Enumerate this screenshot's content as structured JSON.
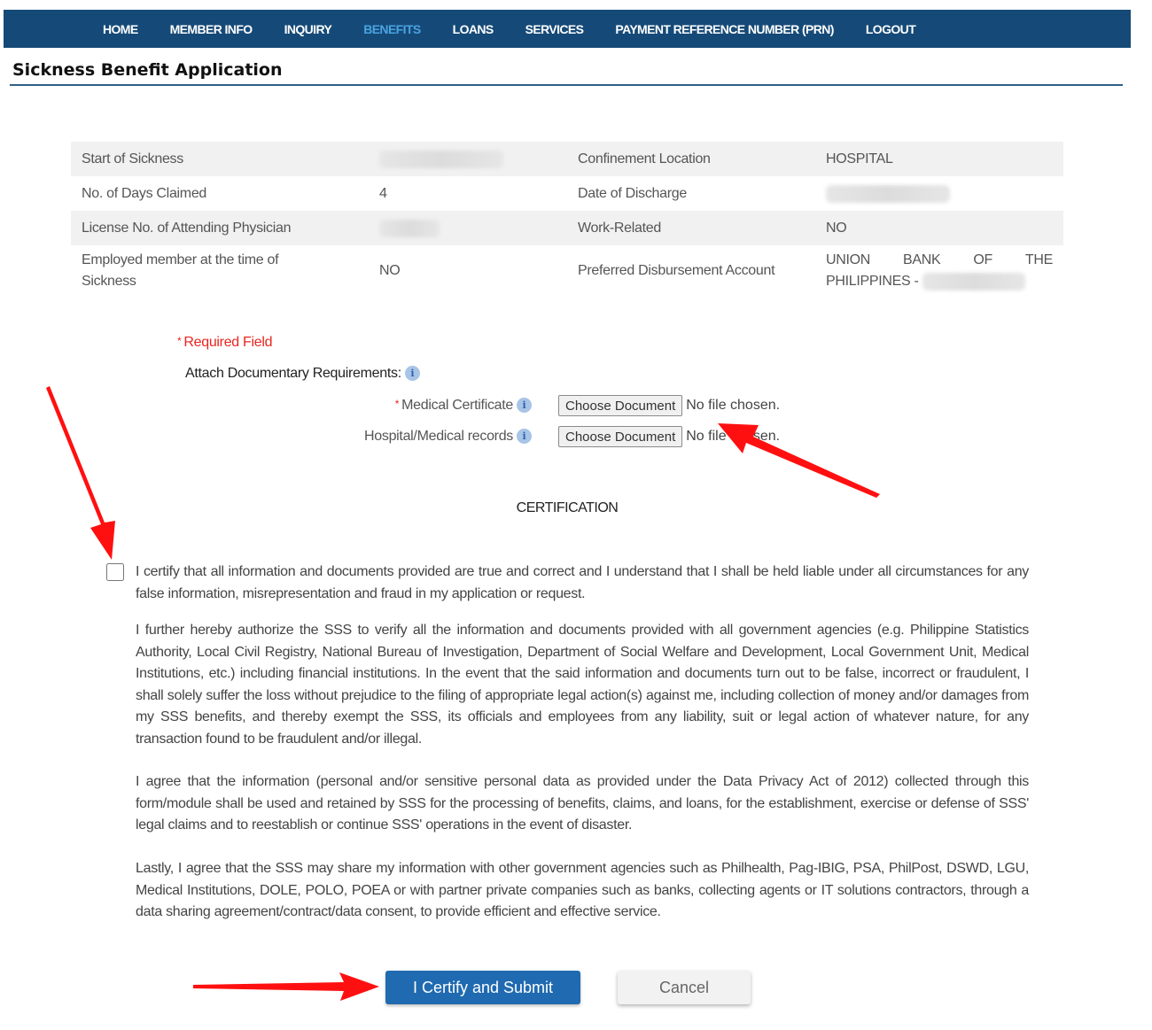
{
  "nav": {
    "items": [
      {
        "label": "HOME",
        "active": false
      },
      {
        "label": "MEMBER INFO",
        "active": false
      },
      {
        "label": "INQUIRY",
        "active": false
      },
      {
        "label": "BENEFITS",
        "active": true
      },
      {
        "label": "LOANS",
        "active": false
      },
      {
        "label": "SERVICES",
        "active": false
      },
      {
        "label": "PAYMENT REFERENCE NUMBER (PRN)",
        "active": false
      },
      {
        "label": "LOGOUT",
        "active": false
      }
    ]
  },
  "page": {
    "title": "Sickness Benefit Application"
  },
  "details": {
    "rows": [
      {
        "label1": "Start of Sickness",
        "value1": "",
        "label2": "Confinement Location",
        "value2": "HOSPITAL"
      },
      {
        "label1": "No. of Days Claimed",
        "value1": "4",
        "label2": "Date of Discharge",
        "value2": ""
      },
      {
        "label1": "License No. of Attending Physician",
        "value1": "",
        "label2": "Work-Related",
        "value2": "NO"
      },
      {
        "label1": "Employed member at the time of Sickness",
        "value1": "NO",
        "label2": "Preferred Disbursement Account",
        "value2_words": [
          "UNION",
          "BANK",
          "OF",
          "THE"
        ],
        "value2_line2": "PHILIPPINES -"
      }
    ]
  },
  "attachments": {
    "required_note": "Required Field",
    "required_marker": "*",
    "section_label": "Attach Documentary Requirements:",
    "info_glyph": "i",
    "documents": [
      {
        "label": "Medical Certificate",
        "required": true,
        "button": "Choose Document",
        "status": "No file chosen."
      },
      {
        "label": "Hospital/Medical records",
        "required": false,
        "button": "Choose Document",
        "status": "No file chosen."
      }
    ]
  },
  "certification": {
    "title": "CERTIFICATION",
    "checked": false,
    "paragraphs": [
      "I certify that all information and documents provided are true and correct and I understand that I shall be held liable under all circumstances for any false information, misrepresentation and fraud in my application or request.",
      "I further hereby authorize the SSS to verify all the information and documents provided with all government agencies (e.g. Philippine Statistics Authority, Local Civil Registry, National Bureau of Investigation, Department of Social Welfare and Development, Local Government Unit, Medical Institutions, etc.) including financial institutions. In the event that the said information and documents turn out to be false, incorrect or fraudulent, I shall solely suffer the loss without prejudice to the filing of appropriate legal action(s) against me, including collection of money and/or damages from my SSS benefits, and thereby exempt the SSS, its officials and employees from any liability, suit or legal action of whatever nature, for any transaction found to be fraudulent and/or illegal.",
      "I agree that the information (personal and/or sensitive personal data as provided under the Data Privacy Act of 2012) collected through this form/module shall be used and retained by SSS for the processing of benefits, claims, and loans, for the establishment, exercise or defense of SSS' legal claims and to reestablish or continue SSS' operations in the event of disaster.",
      "Lastly, I agree that the SSS may share my information with other government agencies such as Philhealth, Pag-IBIG, PSA, PhilPost, DSWD, LGU, Medical Institutions, DOLE, POLO, POEA or with partner private companies such as banks, collecting agents or IT solutions contractors, through a data sharing agreement/contract/data consent, to provide efficient and effective service."
    ]
  },
  "actions": {
    "submit_label": "I Certify and Submit",
    "cancel_label": "Cancel"
  },
  "colors": {
    "nav_bg": "#154a78",
    "nav_active": "#4aa3e0",
    "required": "#e8261f",
    "primary_button": "#1f6ab0",
    "annotation_arrow": "#ff0000"
  }
}
